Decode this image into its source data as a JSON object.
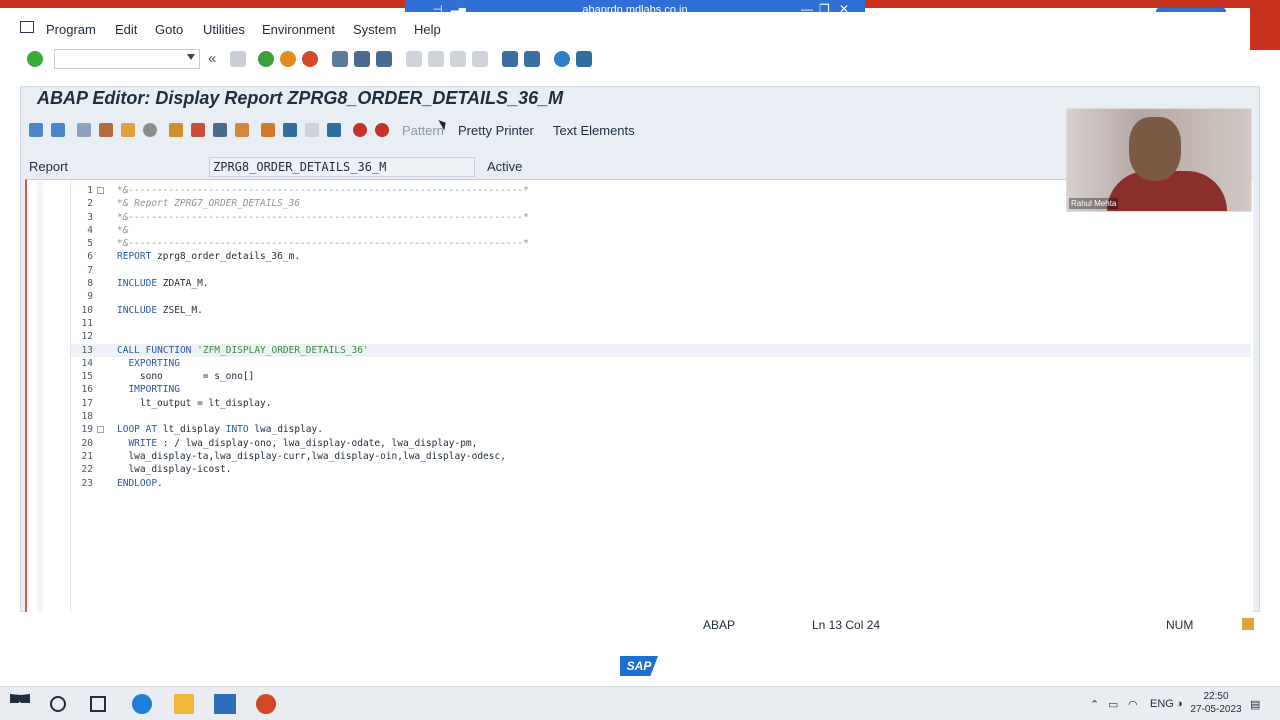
{
  "remote": {
    "host": "abaprdp.mdlabs.co.in",
    "pin": "⊣",
    "signal": "▂▄",
    "min": "—",
    "restore": "❐",
    "close": "✕"
  },
  "window_controls": {
    "min": "—",
    "restore": "❐",
    "close": "✕"
  },
  "menu": [
    "Program",
    "Edit",
    "Goto",
    "Utilities",
    "Environment",
    "System",
    "Help"
  ],
  "toolbar": {
    "command_value": "",
    "back": "«"
  },
  "title": "ABAP Editor: Display Report ZPRG8_ORDER_DETAILS_36_M",
  "app_toolbar": {
    "pattern": "Pattern",
    "pretty_printer": "Pretty Printer",
    "text_elements": "Text Elements"
  },
  "report": {
    "label": "Report",
    "name": "ZPRG8_ORDER_DETAILS_36_M",
    "status": "Active"
  },
  "code": [
    {
      "n": "1",
      "t": "*&---------------------------------------------------------------------*",
      "c": true,
      "fold": true
    },
    {
      "n": "2",
      "t": "*& Report ZPRG7_ORDER_DETAILS_36",
      "c": true
    },
    {
      "n": "3",
      "t": "*&---------------------------------------------------------------------*",
      "c": true
    },
    {
      "n": "4",
      "t": "*&",
      "c": true
    },
    {
      "n": "5",
      "t": "*&---------------------------------------------------------------------*",
      "c": true
    },
    {
      "n": "6",
      "t": "REPORT zprg8_order_details_36_m."
    },
    {
      "n": "7",
      "t": ""
    },
    {
      "n": "8",
      "t": "INCLUDE ZDATA_M."
    },
    {
      "n": "9",
      "t": ""
    },
    {
      "n": "10",
      "t": "INCLUDE ZSEL_M."
    },
    {
      "n": "11",
      "t": ""
    },
    {
      "n": "12",
      "t": ""
    },
    {
      "n": "13",
      "t": "CALL FUNCTION 'ZFM_DISPLAY_ORDER_DETAILS_36'",
      "cur": true
    },
    {
      "n": "14",
      "t": "  EXPORTING"
    },
    {
      "n": "15",
      "t": "    sono       = s_ono[]"
    },
    {
      "n": "16",
      "t": "  IMPORTING"
    },
    {
      "n": "17",
      "t": "    lt_output = lt_display."
    },
    {
      "n": "18",
      "t": ""
    },
    {
      "n": "19",
      "t": "LOOP AT lt_display INTO lwa_display.",
      "fold": true
    },
    {
      "n": "20",
      "t": "  WRITE : / lwa_display-ono, lwa_display-odate, lwa_display-pm,"
    },
    {
      "n": "21",
      "t": "  lwa_display-ta,lwa_display-curr,lwa_display-oin,lwa_display-odesc,"
    },
    {
      "n": "22",
      "t": "  lwa_display-icost."
    },
    {
      "n": "23",
      "t": "ENDLOOP."
    }
  ],
  "status": {
    "lang": "ABAP",
    "position": "Ln 13 Col 24",
    "num": "NUM"
  },
  "sap_logo": "SAP",
  "webcam": {
    "name": "Rahul Mehta"
  },
  "taskbar": {
    "lang": "ENG",
    "time": "22:50",
    "date": "27-05-2023"
  }
}
